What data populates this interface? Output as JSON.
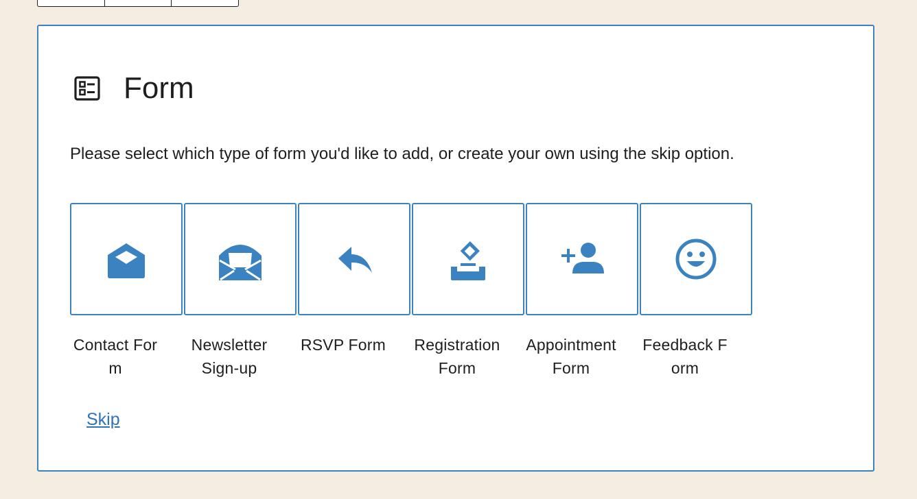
{
  "placeholder": {
    "title": "Form",
    "title_icon": "form-block-icon",
    "instructions": "Please select which type of form you'd like to add, or create your own using the skip option.",
    "skip_label": "Skip"
  },
  "variations": [
    {
      "label": "Contact Form",
      "icon": "open-envelope-icon"
    },
    {
      "label": "Newsletter Sign-up",
      "icon": "envelope-letter-icon"
    },
    {
      "label": "RSVP Form",
      "icon": "reply-arrow-icon"
    },
    {
      "label": "Registration Form",
      "icon": "ballot-box-icon"
    },
    {
      "label": "Appointment Form",
      "icon": "add-person-icon"
    },
    {
      "label": "Feedback Form",
      "icon": "smiley-face-icon"
    }
  ],
  "colors": {
    "accent": "#3b82c0",
    "link": "#2e74b5",
    "background": "#f5ede2",
    "text": "#1e1e1e"
  }
}
